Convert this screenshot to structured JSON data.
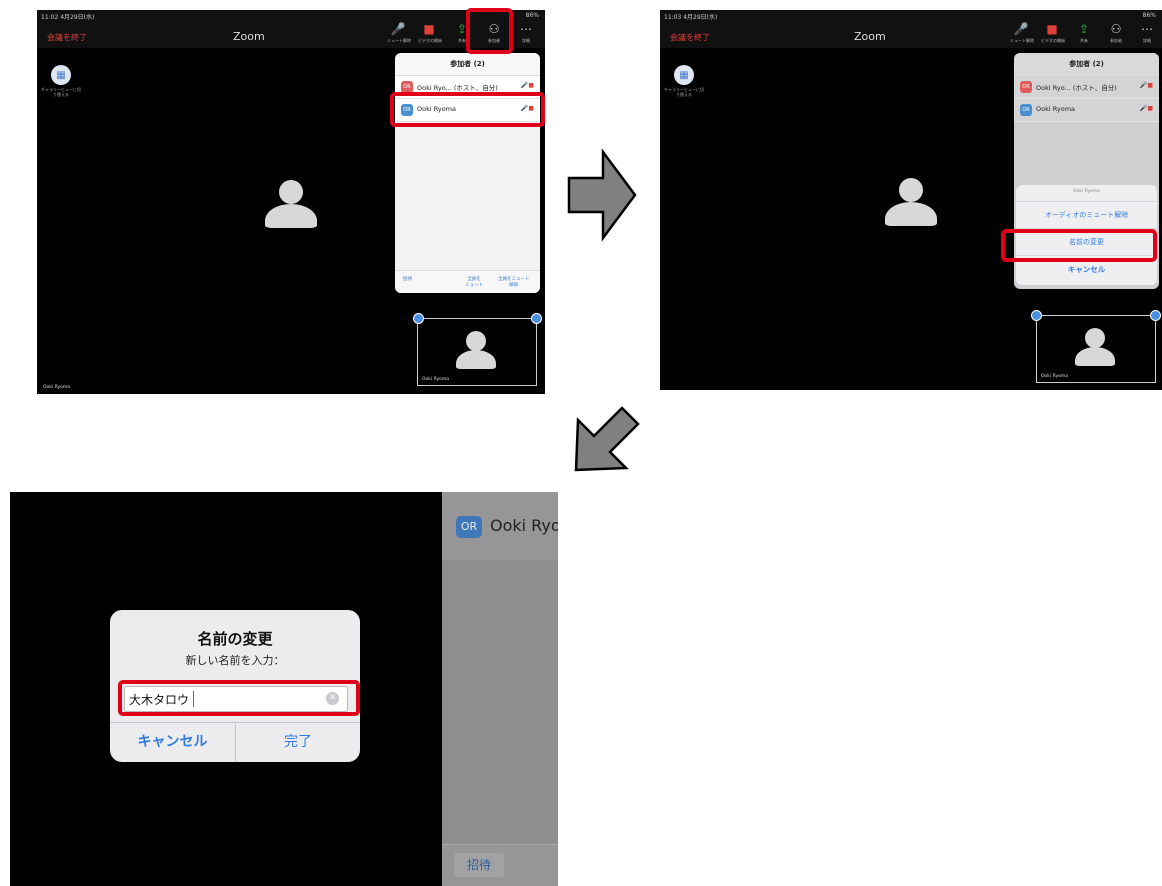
{
  "panel1": {
    "status_time": "11:02  4月29日(水)",
    "status_battery": "86%",
    "leave_label": "会議を終了",
    "title": "Zoom",
    "toolbar": [
      "ミュート解除",
      "ビデオの開始",
      "共有",
      "参加者",
      "詳細"
    ],
    "gallery_label": "ギャラリービューに切り替える",
    "participants_header": "参加者 (2)",
    "participants": [
      {
        "initials": "OR",
        "name": "Ooki Ryo...  (ホスト、自分)",
        "color": "#e05b5b"
      },
      {
        "initials": "OR",
        "name": "Ooki Ryoma",
        "color": "#4a90d0"
      }
    ],
    "footer_invite": "招待",
    "footer_mute_all": "全員を\nミュート",
    "footer_unmute_all": "全員をミュート\n解除",
    "self_name": "Ooki Ryoma",
    "bottom_name": "Ooki Ryoma"
  },
  "panel2": {
    "status_time": "11:03  4月29日(水)",
    "status_battery": "86%",
    "leave_label": "会議を終了",
    "title": "Zoom",
    "toolbar": [
      "ミュート解除",
      "ビデオの開始",
      "共有",
      "参加者",
      "詳細"
    ],
    "gallery_label": "ギャラリービューに切り替える",
    "participants_header": "参加者 (2)",
    "participants": [
      {
        "initials": "OR",
        "name": "Ooki Ryo...  (ホスト、自分)",
        "color": "#e05b5b"
      },
      {
        "initials": "OR",
        "name": "Ooki Ryoma",
        "color": "#4a90d0"
      }
    ],
    "sheet_title": "Ooki Ryoma",
    "sheet_unmute": "オーディオのミュート解除",
    "sheet_rename": "名前の変更",
    "sheet_cancel": "キャンセル",
    "self_name": "Ooki Ryoma"
  },
  "panel3": {
    "side_badge": "OR",
    "side_name": "Ooki Ryoma",
    "dialog_title": "名前の変更",
    "dialog_subtitle": "新しい名前を入力：",
    "input_value": "大木タロウ",
    "cancel_label": "キャンセル",
    "done_label": "完了",
    "invite_label": "招待"
  },
  "colors": {
    "highlight": "#e0001a",
    "arrow_fill": "#808080",
    "ios_blue": "#2f7be0"
  }
}
